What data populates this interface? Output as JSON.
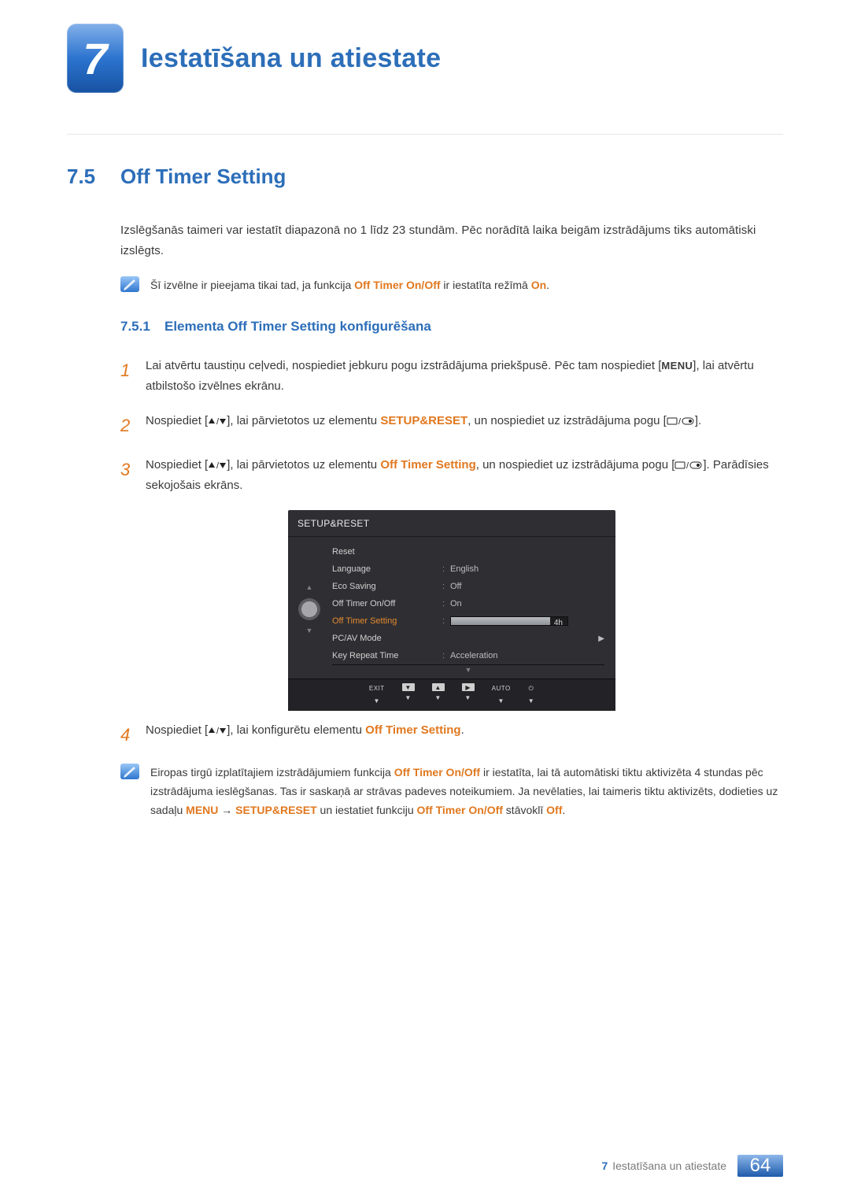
{
  "chapter": {
    "number": "7",
    "title": "Iestatīšana un atiestate"
  },
  "section": {
    "number": "7.5",
    "title": "Off Timer Setting"
  },
  "intro": "Izslēgšanās taimeri var iestatīt diapazonā no 1 līdz 23 stundām. Pēc norādītā laika beigām izstrādājums tiks automātiski izslēgts.",
  "note1": {
    "pre": "Šī izvēlne ir pieejama tikai tad, ja funkcija ",
    "hl1": "Off Timer On/Off",
    "mid": " ir iestatīta režīmā ",
    "hl2": "On",
    "post": "."
  },
  "subsection": {
    "number": "7.5.1",
    "title": "Elementa Off Timer Setting konfigurēšana"
  },
  "steps": {
    "s1a": "Lai atvērtu taustiņu ceļvedi, nospiediet jebkuru pogu izstrādājuma priekšpusē. Pēc tam nospiediet [",
    "s1menu": "MENU",
    "s1b": "], lai atvērtu atbilstošo izvēlnes ekrānu.",
    "s2a": "Nospiediet [",
    "s2b": "], lai pārvietotos uz elementu ",
    "s2hl": "SETUP&RESET",
    "s2c": ", un nospiediet uz izstrādājuma pogu [",
    "s2d": "].",
    "s3a": "Nospiediet [",
    "s3b": "], lai pārvietotos uz elementu ",
    "s3hl": "Off Timer Setting",
    "s3c": ", un nospiediet uz izstrādājuma pogu [",
    "s3d": "]. Parādīsies sekojošais ekrāns.",
    "s4a": "Nospiediet [",
    "s4b": "], lai konfigurētu elementu ",
    "s4hl": "Off Timer Setting",
    "s4c": "."
  },
  "osd": {
    "title": "SETUP&RESET",
    "items": {
      "reset": "Reset",
      "language": "Language",
      "language_v": "English",
      "eco": "Eco Saving",
      "eco_v": "Off",
      "onoff": "Off Timer On/Off",
      "onoff_v": "On",
      "setting": "Off Timer Setting",
      "setting_v": "4h",
      "pcav": "PC/AV Mode",
      "keyrep": "Key Repeat Time",
      "keyrep_v": "Acceleration"
    },
    "footer": {
      "exit": "EXIT",
      "auto": "AUTO"
    }
  },
  "note2": {
    "t1": "Eiropas tirgū izplatītajiem izstrādājumiem funkcija ",
    "hl1": "Off Timer On/Off",
    "t2": " ir iestatīta, lai tā automātiski tiktu aktivizēta 4 stundas pēc izstrādājuma ieslēgšanas. Tas ir saskaņā ar strāvas padeves noteikumiem. Ja nevēlaties, lai taimeris tiktu aktivizēts, dodieties uz sadaļu ",
    "hl2": "MENU",
    "arrow": " → ",
    "hl3": "SETUP&RESET",
    "t3": " un iestatiet funkciju ",
    "hl4": "Off Timer On/Off",
    "t4": " stāvoklī ",
    "hl5": "Off",
    "t5": "."
  },
  "footer": {
    "chapnum": "7",
    "chaptitle": "Iestatīšana un atiestate",
    "page": "64"
  }
}
